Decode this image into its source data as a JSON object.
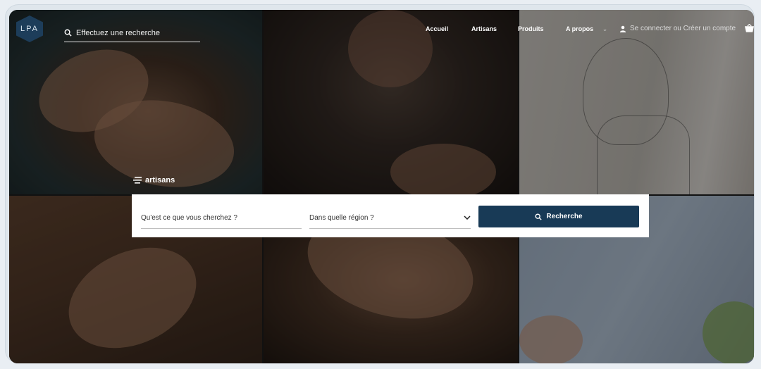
{
  "brand": {
    "logo_text": "LPA"
  },
  "header": {
    "search_placeholder": "Effectuez une recherche",
    "nav": [
      "Accueil",
      "Artisans",
      "Produits",
      "A propos"
    ],
    "account_label": "Se connecter ou Créer un compte"
  },
  "hero": {
    "section_label": "artisans",
    "search_form": {
      "what_placeholder": "Qu'est ce que vous cherchez ?",
      "region_placeholder": "Dans quelle région ?",
      "submit_label": "Recherche"
    }
  },
  "icons": {
    "header_search": "search-icon",
    "account": "user-icon",
    "cart": "cart-icon",
    "nav_more": "chevron-down-icon",
    "list": "list-icon",
    "select": "chevron-down-icon",
    "submit": "search-icon"
  },
  "colors": {
    "brand": "#183a56",
    "logo": "#1d3d5a"
  }
}
